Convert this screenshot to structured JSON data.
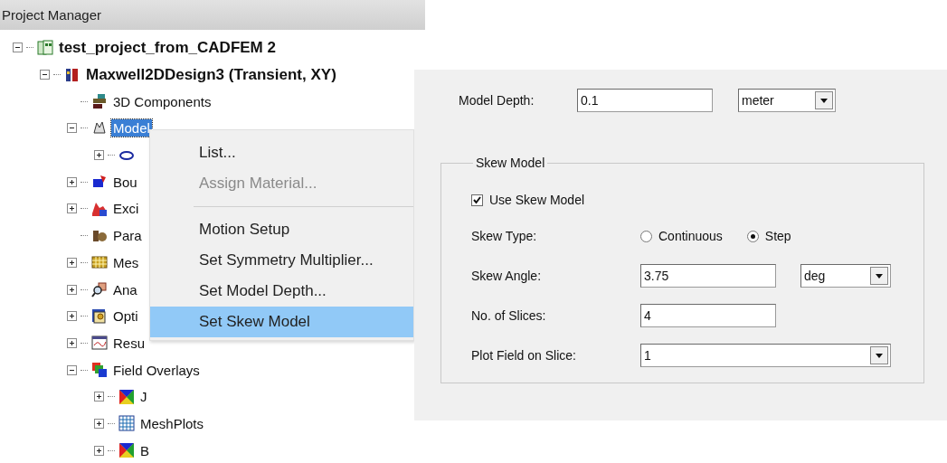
{
  "panel": {
    "title": "Project Manager"
  },
  "tree": [
    {
      "label": "test_project_from_CADFEM 2",
      "kind": "project",
      "bold": true,
      "expanded": true,
      "selected": false,
      "children": [
        {
          "label": "Maxwell2DDesign3 (Transient, XY)",
          "kind": "design",
          "bold": true,
          "expanded": true,
          "selected": false,
          "children": [
            {
              "label": "3D Components",
              "kind": "components",
              "selected": false
            },
            {
              "label": "Model",
              "kind": "model",
              "expanded": true,
              "selected": true,
              "children": [
                {
                  "kind": "object",
                  "expanded": false
                }
              ]
            },
            {
              "label": "Bou",
              "kind": "boundaries",
              "expanded": false,
              "selected": false
            },
            {
              "label": "Exci",
              "kind": "excitations",
              "expanded": false,
              "selected": false
            },
            {
              "label": "Para",
              "kind": "parameters",
              "selected": false
            },
            {
              "label": "Mes",
              "kind": "mesh",
              "expanded": false,
              "selected": false
            },
            {
              "label": "Ana",
              "kind": "analysis",
              "expanded": false,
              "selected": false
            },
            {
              "label": "Opti",
              "kind": "optimetrics",
              "expanded": false,
              "selected": false
            },
            {
              "label": "Resu",
              "kind": "results",
              "expanded": false,
              "selected": false
            },
            {
              "label": "Field Overlays",
              "kind": "overlays",
              "expanded": true,
              "selected": false,
              "children": [
                {
                  "label": "J",
                  "kind": "field-plot",
                  "expanded": false,
                  "selected": false
                },
                {
                  "label": "MeshPlots",
                  "kind": "mesh-plot",
                  "expanded": false,
                  "selected": false
                },
                {
                  "label": "B",
                  "kind": "field-plot",
                  "expanded": false,
                  "selected": false
                }
              ]
            }
          ]
        }
      ]
    }
  ],
  "context_menu": [
    {
      "kind": "item",
      "label": "List...",
      "disabled": false,
      "selected": false
    },
    {
      "kind": "item",
      "label": "Assign Material...",
      "disabled": true,
      "selected": false
    },
    {
      "kind": "separator"
    },
    {
      "kind": "item",
      "label": "Motion Setup",
      "disabled": false,
      "selected": false
    },
    {
      "kind": "item",
      "label": "Set Symmetry Multiplier...",
      "disabled": false,
      "selected": false
    },
    {
      "kind": "item",
      "label": "Set Model Depth...",
      "disabled": false,
      "selected": false
    },
    {
      "kind": "item",
      "label": "Set Skew Model",
      "disabled": false,
      "selected": true
    }
  ],
  "dialog": {
    "model_depth": {
      "label": "Model Depth:",
      "value": "0.1",
      "unit": "meter"
    },
    "skew_group": {
      "title": "Skew Model",
      "use_skew": {
        "label": "Use Skew Model",
        "checked": true
      },
      "skew_type": {
        "label": "Skew Type:",
        "options": [
          {
            "label": "Continuous",
            "selected": false
          },
          {
            "label": "Step",
            "selected": true
          }
        ]
      },
      "skew_angle": {
        "label": "Skew Angle:",
        "value": "3.75",
        "unit": "deg"
      },
      "slices": {
        "label": "No. of Slices:",
        "value": "4"
      },
      "plot_field": {
        "label": "Plot Field on Slice:",
        "value": "1"
      }
    }
  }
}
